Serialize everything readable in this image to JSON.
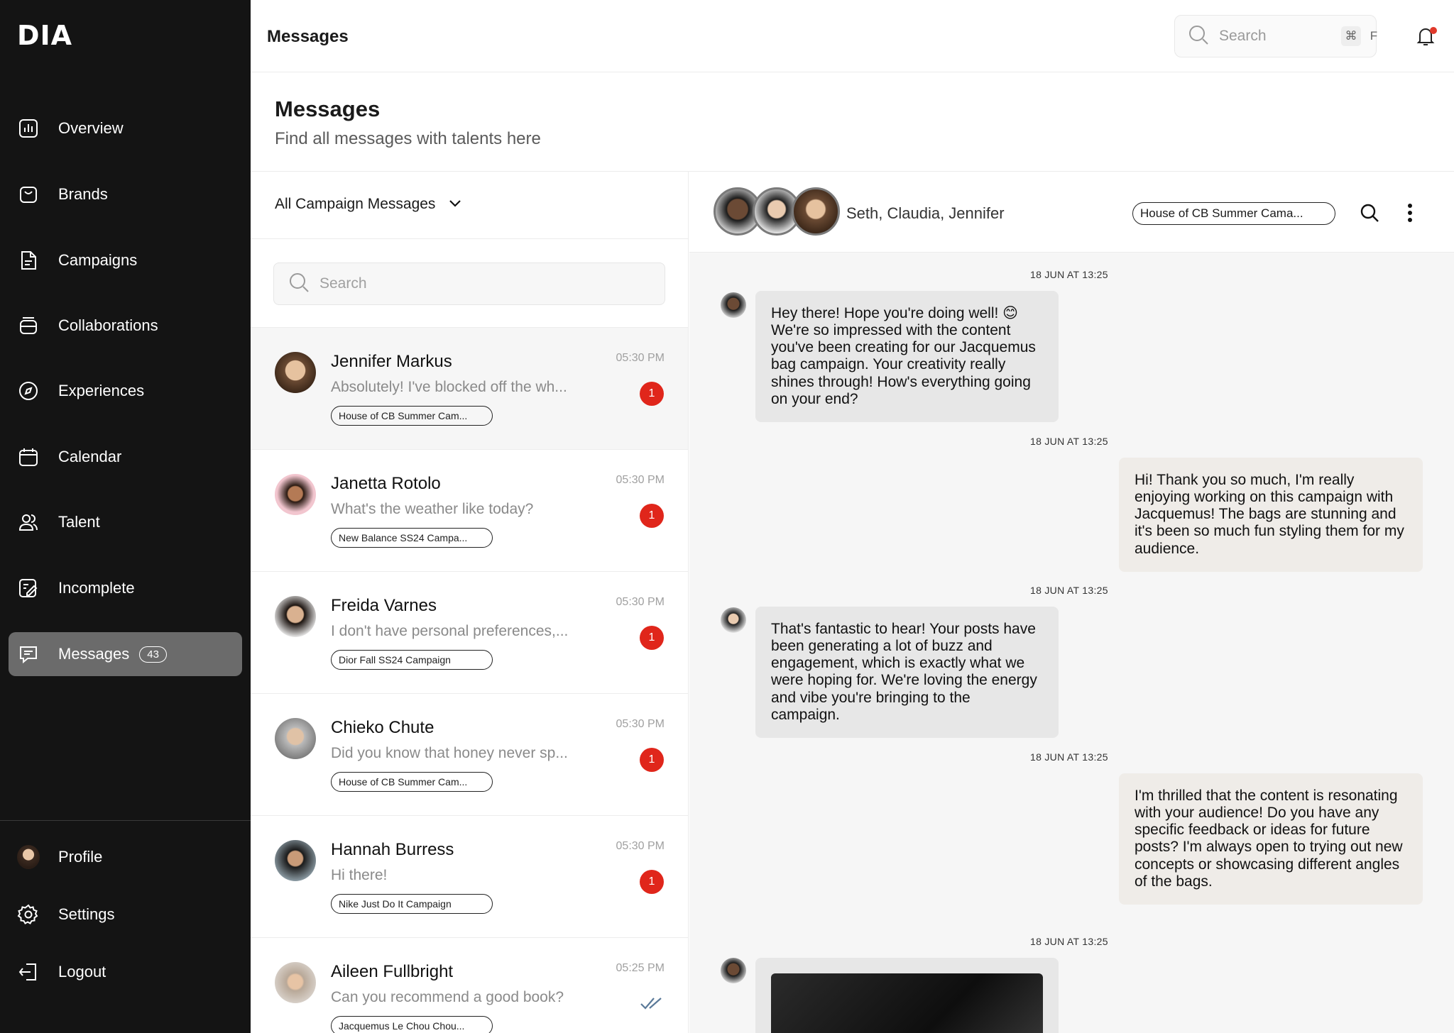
{
  "app": {
    "logo": "DIA",
    "topbar_title": "Messages",
    "search_placeholder": "Search",
    "kbd_cmd": "⌘",
    "kbd_key": "F"
  },
  "sidebar": {
    "items": [
      {
        "label": "Overview",
        "icon": "bar-chart-icon"
      },
      {
        "label": "Brands",
        "icon": "bag-icon"
      },
      {
        "label": "Campaigns",
        "icon": "document-icon"
      },
      {
        "label": "Collaborations",
        "icon": "stack-icon"
      },
      {
        "label": "Experiences",
        "icon": "compass-icon"
      },
      {
        "label": "Calendar",
        "icon": "calendar-icon"
      },
      {
        "label": "Talent",
        "icon": "users-icon"
      },
      {
        "label": "Incomplete",
        "icon": "edit-icon"
      },
      {
        "label": "Messages",
        "icon": "chat-icon",
        "badge": "43",
        "active": true
      }
    ],
    "bottom": [
      {
        "label": "Profile",
        "icon": "avatar"
      },
      {
        "label": "Settings",
        "icon": "gear-icon"
      },
      {
        "label": "Logout",
        "icon": "logout-icon"
      }
    ]
  },
  "page": {
    "title": "Messages",
    "subtitle": "Find all messages with talents here"
  },
  "list": {
    "filter_label": "All Campaign Messages",
    "search_placeholder": "Search",
    "conversations": [
      {
        "name": "Jennifer Markus",
        "preview": "Absolutely! I've blocked off the wh...",
        "time": "05:30 PM",
        "unread": "1",
        "tag": "House of CB Summer Cam...",
        "selected": true
      },
      {
        "name": "Janetta Rotolo",
        "preview": "What's the weather like today?",
        "time": "05:30 PM",
        "unread": "1",
        "tag": "New Balance SS24 Campa..."
      },
      {
        "name": "Freida Varnes",
        "preview": "I don't have personal preferences,...",
        "time": "05:30 PM",
        "unread": "1",
        "tag": "Dior Fall SS24 Campaign"
      },
      {
        "name": "Chieko Chute",
        "preview": "Did you know that honey never sp...",
        "time": "05:30 PM",
        "unread": "1",
        "tag": "House of CB Summer Cam..."
      },
      {
        "name": "Hannah Burress",
        "preview": "Hi there!",
        "time": "05:30 PM",
        "unread": "1",
        "tag": "Nike Just Do It Campaign"
      },
      {
        "name": "Aileen Fullbright",
        "preview": "Can you recommend a good book?",
        "time": "05:25 PM",
        "unread": "",
        "tag": "Jacquemus Le Chou Chou..."
      }
    ]
  },
  "chat": {
    "participants": "Seth, Claudia, Jennifer",
    "campaign_tag": "House of CB Summer Cama...",
    "messages": [
      {
        "stamp": "18 JUN AT 13:25",
        "dir": "in",
        "text": "Hey there! Hope you're doing well! 😊 We're so impressed with the content you've been creating for our Jacquemus bag campaign. Your creativity really shines through! How's everything going on your end?"
      },
      {
        "stamp": "18 JUN AT 13:25",
        "dir": "out",
        "text": "Hi! Thank you so much, I'm really enjoying working on this campaign with Jacquemus! The bags are stunning and it's been so much fun styling them for my audience."
      },
      {
        "stamp": "18 JUN AT 13:25",
        "dir": "in",
        "text": "That's fantastic to hear! Your posts have been generating a lot of buzz and engagement, which is exactly what we were hoping for. We're loving the energy and vibe you're bringing to the campaign."
      },
      {
        "stamp": "18 JUN AT 13:25",
        "dir": "out",
        "text": "I'm thrilled that the content is resonating with your audience! Do you have any specific feedback or ideas for future posts? I'm always open to trying out new concepts or showcasing different angles of the bags."
      },
      {
        "stamp": "18 JUN AT 13:25",
        "dir": "in",
        "text": ""
      }
    ]
  },
  "colors": {
    "sidebar_bg": "#141414",
    "active_item": "#6b6b6b",
    "unread_badge": "#e0261b",
    "read_check": "#5b7a99"
  }
}
